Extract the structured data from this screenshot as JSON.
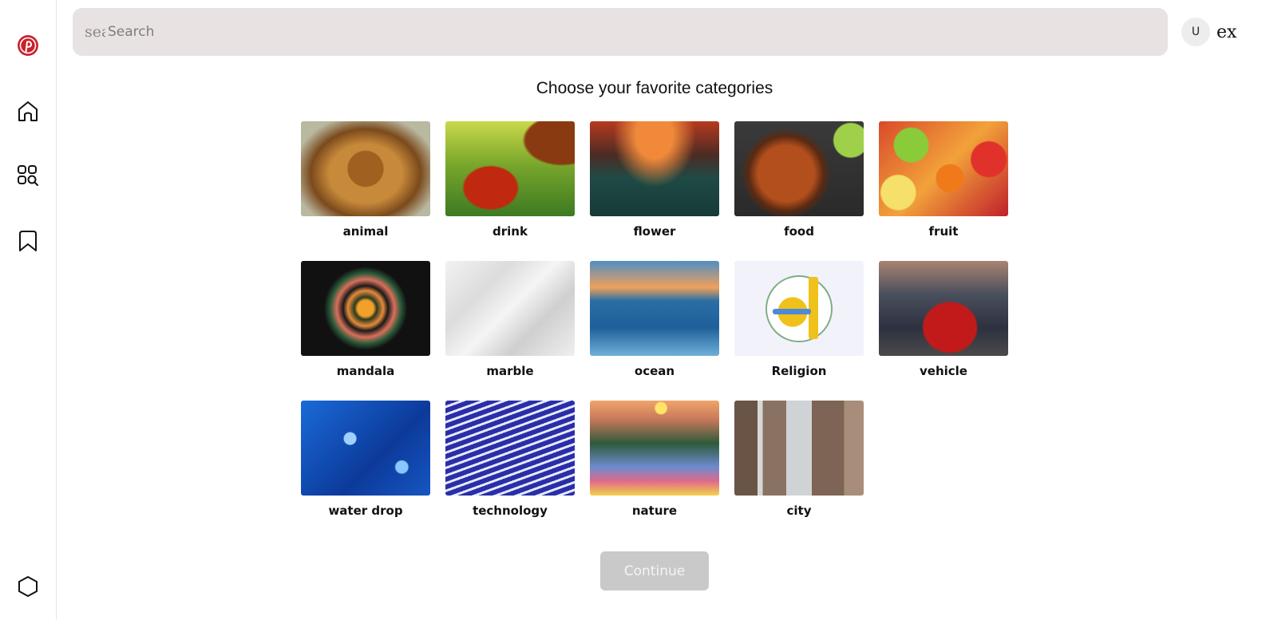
{
  "sidebar": {
    "logo_icon": "pinterest-logo-icon",
    "brand_color": "#c8232c",
    "items": [
      {
        "name": "home",
        "icon": "home-icon"
      },
      {
        "name": "explore",
        "icon": "grid-search-icon"
      },
      {
        "name": "saved",
        "icon": "bookmark-icon"
      },
      {
        "name": "settings",
        "icon": "hexagon-icon"
      }
    ]
  },
  "header": {
    "search_icon_text": "search",
    "search_placeholder": "Search",
    "search_value": "",
    "search_bg": "#e8e2e3",
    "avatar_initial": "U",
    "user_label": "ex"
  },
  "main": {
    "title": "Choose your favorite categories",
    "categories": [
      {
        "label": "animal"
      },
      {
        "label": "drink"
      },
      {
        "label": "flower"
      },
      {
        "label": "food"
      },
      {
        "label": "fruit"
      },
      {
        "label": "mandala"
      },
      {
        "label": "marble"
      },
      {
        "label": "ocean"
      },
      {
        "label": "Religion"
      },
      {
        "label": "vehicle"
      },
      {
        "label": "water drop"
      },
      {
        "label": "technology"
      },
      {
        "label": "nature"
      },
      {
        "label": "city"
      }
    ],
    "continue_label": "Continue",
    "continue_bg": "#c9c9c9"
  }
}
